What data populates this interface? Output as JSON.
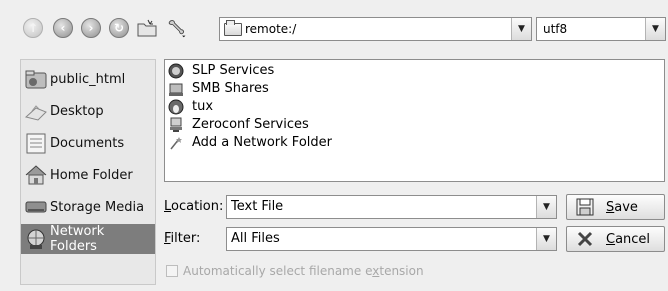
{
  "toolbar": {
    "nav_icons": [
      "up-icon",
      "back-icon",
      "forward-icon",
      "reload-icon",
      "new-folder-icon",
      "configure-icon"
    ],
    "url": "remote:/",
    "encoding": "utf8"
  },
  "places": [
    {
      "label": "public_html",
      "icon": "folder-icon"
    },
    {
      "label": "Desktop",
      "icon": "desktop-icon"
    },
    {
      "label": "Documents",
      "icon": "documents-icon"
    },
    {
      "label": "Home Folder",
      "icon": "home-icon"
    },
    {
      "label": "Storage Media",
      "icon": "storage-icon"
    },
    {
      "label": "Network Folders",
      "icon": "network-icon",
      "selected": true
    }
  ],
  "files": [
    {
      "label": "SLP Services",
      "icon": "slp-icon"
    },
    {
      "label": "SMB Shares",
      "icon": "smb-icon"
    },
    {
      "label": "tux",
      "icon": "tux-icon"
    },
    {
      "label": "Zeroconf Services",
      "icon": "zeroconf-icon"
    },
    {
      "label": "Add a Network Folder",
      "icon": "wizard-icon"
    }
  ],
  "location": {
    "label_pre": "",
    "label_u": "L",
    "label_post": "ocation:",
    "value": "Text File"
  },
  "filter": {
    "label_pre": "",
    "label_u": "F",
    "label_post": "ilter:",
    "value": "All Files"
  },
  "buttons": {
    "save": {
      "pre": "",
      "u": "S",
      "post": "ave"
    },
    "cancel": {
      "pre": "",
      "u": "C",
      "post": "ancel"
    }
  },
  "auto_ext": {
    "pre": "Automatically select filename e",
    "u": "x",
    "post": "tension",
    "checked": false
  }
}
